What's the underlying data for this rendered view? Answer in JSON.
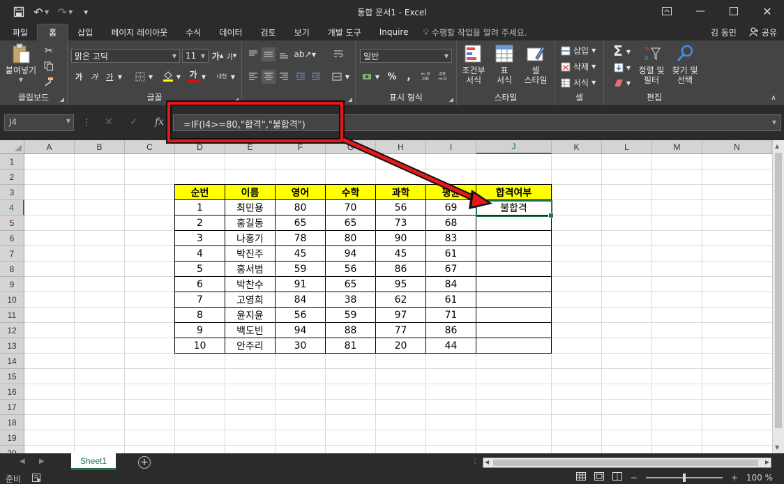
{
  "window": {
    "title": "통합 문서1 - Excel",
    "user": "김 동민",
    "share_label": "공유"
  },
  "ribbon_tabs": [
    {
      "label": "파일",
      "active": false
    },
    {
      "label": "홈",
      "active": true
    },
    {
      "label": "삽입",
      "active": false
    },
    {
      "label": "페이지 레이아웃",
      "active": false
    },
    {
      "label": "수식",
      "active": false
    },
    {
      "label": "데이터",
      "active": false
    },
    {
      "label": "검토",
      "active": false
    },
    {
      "label": "보기",
      "active": false
    },
    {
      "label": "개발 도구",
      "active": false
    },
    {
      "label": "Inquire",
      "active": false
    }
  ],
  "tell_me": "수행할 작업을 알려 주세요.",
  "ribbon": {
    "clipboard": {
      "label": "클립보드",
      "paste": "붙여넣기"
    },
    "font": {
      "label": "글꼴",
      "name": "맑은 고딕",
      "size": "11",
      "bold": "가",
      "italic": "가",
      "underline": "가",
      "grow": "가",
      "shrink": "가",
      "font_color_glyph": "가",
      "phonetic": "내천"
    },
    "alignment": {
      "label": "맞춤"
    },
    "number": {
      "label": "표시 형식",
      "format": "일반",
      "percent": "%",
      "comma": ","
    },
    "styles": {
      "label": "스타일",
      "conditional": "조건부\n서식",
      "table": "표\n서식",
      "cell": "셀\n스타일"
    },
    "cells": {
      "label": "셀",
      "insert": "삽입",
      "delete": "삭제",
      "format": "서식"
    },
    "editing": {
      "label": "편집",
      "sort": "정렬 및\n필터",
      "find": "찾기 및\n선택",
      "sigma": "Σ"
    }
  },
  "formula_bar": {
    "name_box": "J4",
    "formula": "=IF(I4>=80,\"합격\",\"불합격\")",
    "fx": "fx"
  },
  "columns": [
    "A",
    "B",
    "C",
    "D",
    "E",
    "F",
    "G",
    "H",
    "I",
    "J",
    "K",
    "L",
    "M",
    "N"
  ],
  "rows": [
    "1",
    "2",
    "3",
    "4",
    "5",
    "6",
    "7",
    "8",
    "9",
    "10",
    "11",
    "12",
    "13",
    "14",
    "15",
    "16",
    "17",
    "18",
    "19",
    "20"
  ],
  "table": {
    "headers": [
      "순번",
      "이름",
      "영어",
      "수학",
      "과학",
      "평균",
      "합격여부"
    ],
    "rows": [
      [
        "1",
        "최민용",
        "80",
        "70",
        "56",
        "69",
        "불합격"
      ],
      [
        "2",
        "홍길동",
        "65",
        "65",
        "73",
        "68",
        ""
      ],
      [
        "3",
        "나홍기",
        "78",
        "80",
        "90",
        "83",
        ""
      ],
      [
        "4",
        "박진주",
        "45",
        "94",
        "45",
        "61",
        ""
      ],
      [
        "5",
        "홍서범",
        "59",
        "56",
        "86",
        "67",
        ""
      ],
      [
        "6",
        "박찬수",
        "91",
        "65",
        "95",
        "84",
        ""
      ],
      [
        "7",
        "고영희",
        "84",
        "38",
        "62",
        "61",
        ""
      ],
      [
        "8",
        "윤지윤",
        "56",
        "59",
        "97",
        "71",
        ""
      ],
      [
        "9",
        "백도빈",
        "94",
        "88",
        "77",
        "86",
        ""
      ],
      [
        "10",
        "안주리",
        "30",
        "81",
        "20",
        "44",
        ""
      ]
    ]
  },
  "sheets": [
    "Sheet1"
  ],
  "status": {
    "mode": "준비",
    "zoom": "100 %"
  },
  "colors": {
    "header_fill": "#ffff00",
    "callout": "#e81818",
    "excel_green": "#217346"
  }
}
